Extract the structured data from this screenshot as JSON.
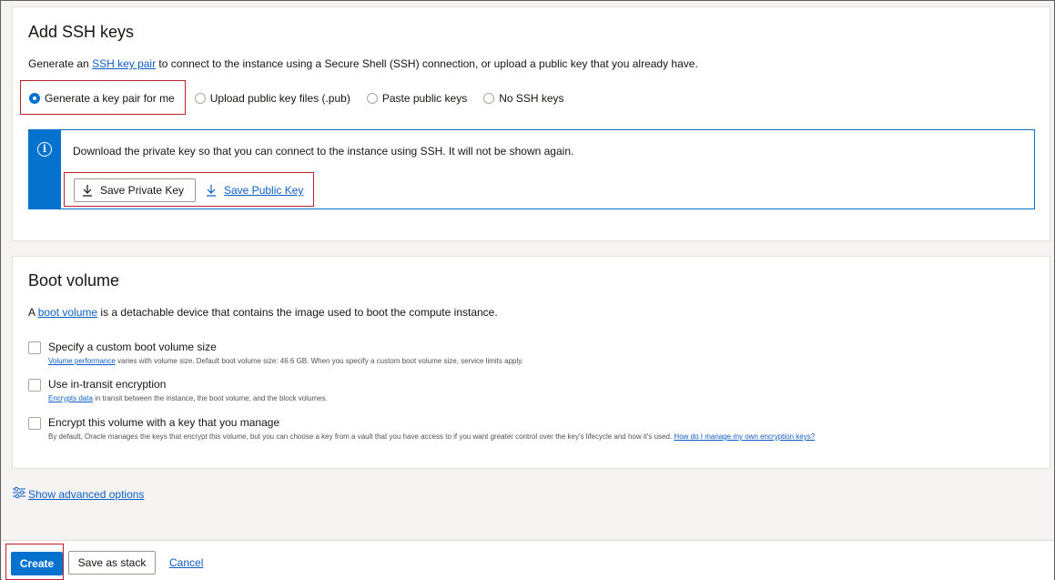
{
  "ssh": {
    "title": "Add SSH keys",
    "desc_prefix": "Generate an ",
    "desc_link": "SSH key pair",
    "desc_suffix": " to connect to the instance using a Secure Shell (SSH) connection, or upload a public key that you already have.",
    "options": [
      {
        "label": "Generate a key pair for me",
        "selected": true
      },
      {
        "label": "Upload public key files (.pub)",
        "selected": false
      },
      {
        "label": "Paste public keys",
        "selected": false
      },
      {
        "label": "No SSH keys",
        "selected": false
      }
    ],
    "notice_text": "Download the private key so that you can connect to the instance using SSH. It will not be shown again.",
    "save_private_label": "Save Private Key",
    "save_public_label": "Save Public Key"
  },
  "boot": {
    "title": "Boot volume",
    "desc_prefix": "A ",
    "desc_link": "boot volume",
    "desc_suffix": " is a detachable device that contains the image used to boot the compute instance.",
    "checkboxes": [
      {
        "label": "Specify a custom boot volume size",
        "sub_link": "Volume performance",
        "sub_text": " varies with volume size. Default boot volume size: 46.6 GB. When you specify a custom boot volume size, service limits apply.",
        "checked": false
      },
      {
        "label": "Use in-transit encryption",
        "sub_link": "Encrypts data",
        "sub_text": " in transit between the instance, the boot volume, and the block volumes.",
        "checked": false
      },
      {
        "label": "Encrypt this volume with a key that you manage",
        "sub_text": "By default, Oracle manages the keys that encrypt this volume, but you can choose a key from a vault that you have access to if you want greater control over the key's lifecycle and how it's used. ",
        "sub_link": "How do I manage my own encryption keys?",
        "checked": false
      }
    ]
  },
  "advanced_label": "Show advanced options",
  "footer": {
    "create_label": "Create",
    "save_stack_label": "Save as stack",
    "cancel_label": "Cancel"
  },
  "colors": {
    "accent": "#0572ce",
    "link": "#0d5ec8",
    "highlight_box": "#c0202d"
  }
}
